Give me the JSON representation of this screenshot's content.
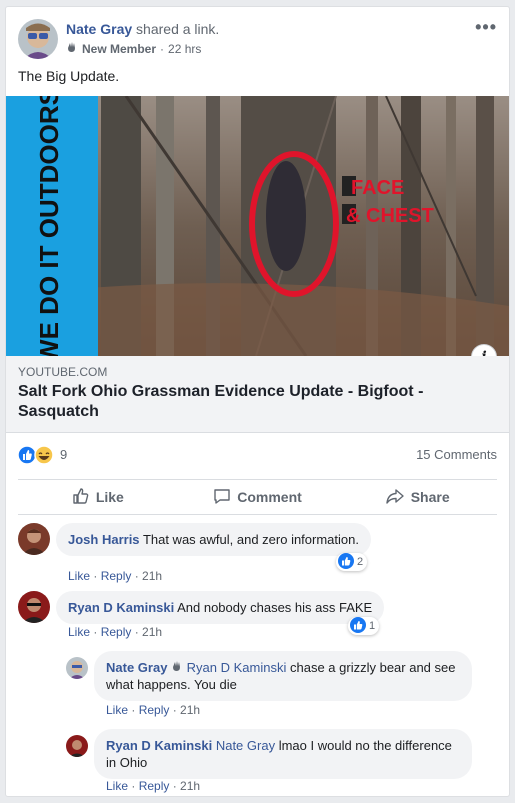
{
  "post": {
    "author": "Nate Gray",
    "action": "shared a link.",
    "badge": "New Member",
    "time": "22 hrs",
    "text": "The Big Update.",
    "more": "•••"
  },
  "link": {
    "thumb_overlay_text": "WE DO IT OUTDOORS",
    "thumb_annotation_line1": "FACE",
    "thumb_annotation_line2": "& CHEST",
    "domain": "YOUTUBE.COM",
    "title": "Salt Fork Ohio Grassman Evidence Update - Bigfoot - Sasquatch"
  },
  "reactions": {
    "count": "9",
    "comments": "15 Comments"
  },
  "actions": {
    "like": "Like",
    "comment": "Comment",
    "share": "Share"
  },
  "comments": [
    {
      "author": "Josh Harris",
      "text": "That was awful, and zero information.",
      "like": "Like",
      "reply": "Reply",
      "time": "21h",
      "reactions": "2"
    },
    {
      "author": "Ryan D Kaminski",
      "text": "And nobody chases his ass FAKE",
      "like": "Like",
      "reply": "Reply",
      "time": "21h",
      "reactions": "1"
    },
    {
      "author": "Nate Gray",
      "mention": "Ryan D Kaminski",
      "text": "chase a grizzly bear and see what happens. You die",
      "like": "Like",
      "reply": "Reply",
      "time": "21h"
    },
    {
      "author": "Ryan D Kaminski",
      "mention": "Nate Gray",
      "text": "lmao I would no the difference in Ohio",
      "like": "Like",
      "reply": "Reply",
      "time": "21h"
    }
  ],
  "colors": {
    "link_blue": "#385898",
    "like_blue": "#1877f2",
    "annotation_red": "#e0142b",
    "banner_blue": "#1aa0e0"
  }
}
